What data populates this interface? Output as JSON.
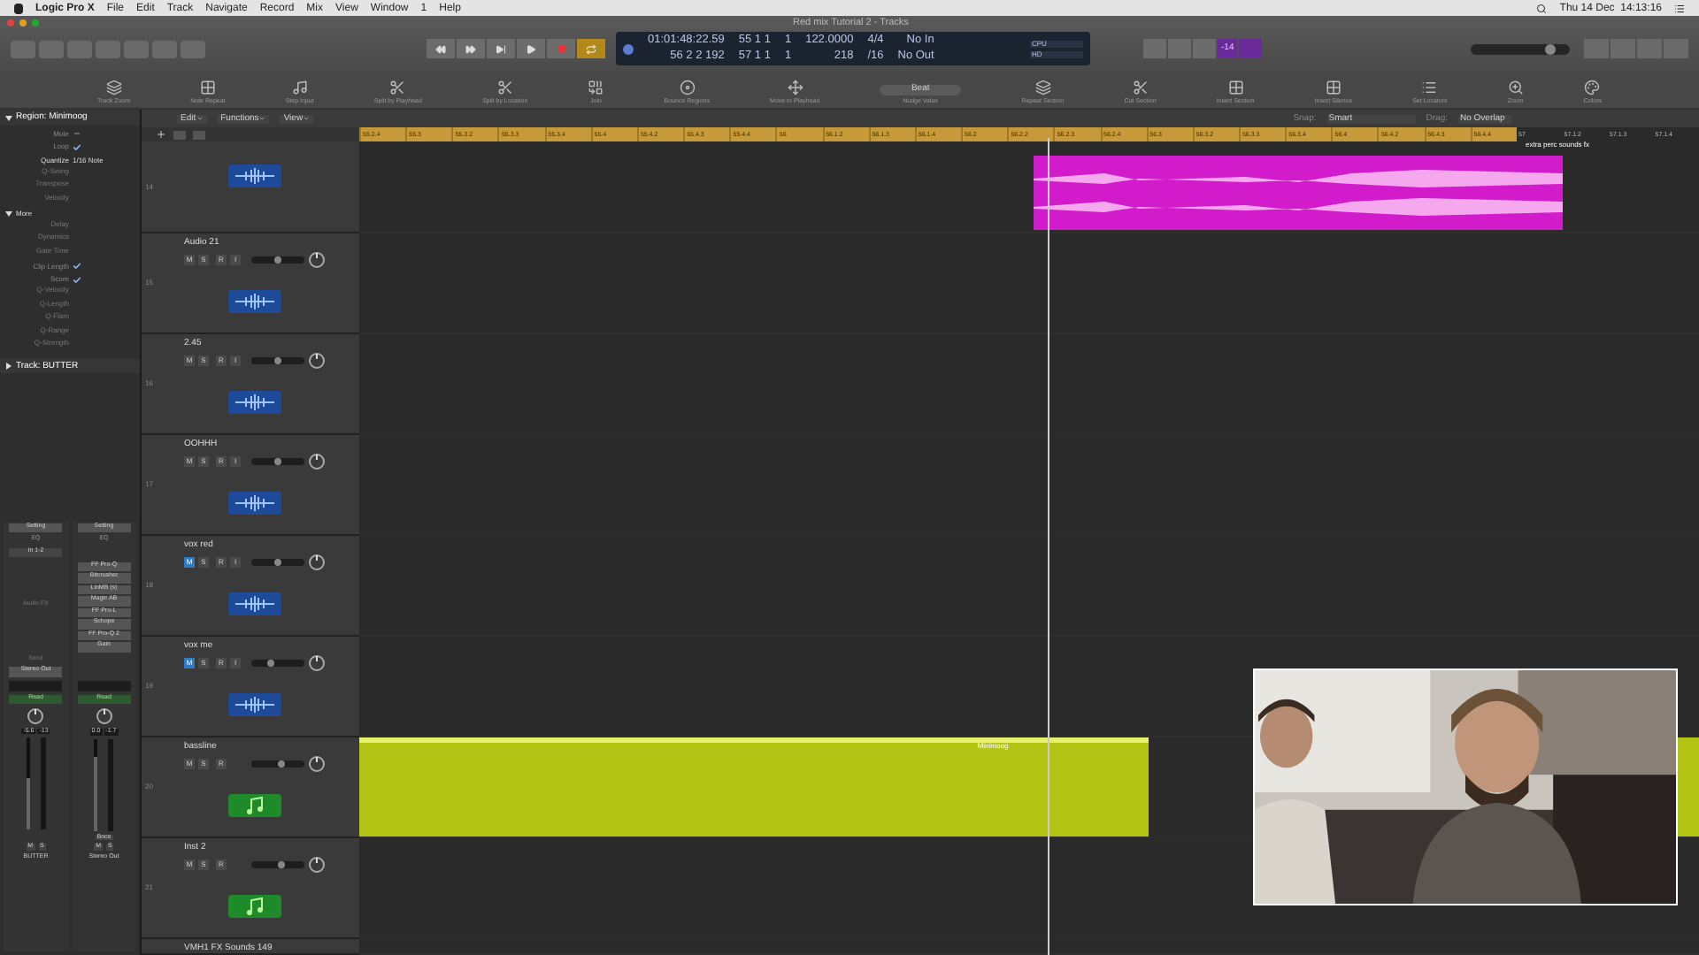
{
  "menu_bar": {
    "app": "Logic Pro X",
    "items": [
      "File",
      "Edit",
      "Track",
      "Navigate",
      "Record",
      "Mix",
      "View",
      "Window",
      "1",
      "Help"
    ],
    "clock": "Thu 14 Dec  14:13:16"
  },
  "window": {
    "title": "Red mix Tutorial 2 - Tracks"
  },
  "lcd": {
    "rows": [
      [
        "01:01:48:22.59",
        "55 1 1",
        "1",
        "122.0000",
        "4/4",
        "No In"
      ],
      [
        "56 2 2 192",
        "57 1 1",
        "1",
        "218",
        "/16",
        "No Out"
      ]
    ],
    "meters": [
      "CPU",
      "HD"
    ]
  },
  "purple_badge": "-14",
  "master_volume": {
    "level": 0.8
  },
  "toolbar": [
    {
      "label": "Track Zoom"
    },
    {
      "label": "Note Repeat"
    },
    {
      "label": "Step Input"
    },
    {
      "label": "Split by Playhead"
    },
    {
      "label": "Split by Location"
    },
    {
      "label": "Join"
    },
    {
      "label": "Bounce Regions"
    },
    {
      "label": "Move to Playhead"
    },
    {
      "label": "Nudge Value",
      "value": "Beat"
    },
    {
      "label": "Repeat Section"
    },
    {
      "label": "Cut Section"
    },
    {
      "label": "Insert Section"
    },
    {
      "label": "Insert Silence"
    },
    {
      "label": "Set Locators"
    },
    {
      "label": "Zoom"
    },
    {
      "label": "Colors"
    }
  ],
  "inspector": {
    "title": "Region: Minimoog",
    "rows": [
      {
        "label": "Mute",
        "kind": "check",
        "checked": false
      },
      {
        "label": "Loop",
        "kind": "check",
        "checked": true
      },
      {
        "label": "Quantize",
        "kind": "value",
        "value": "1/16 Note"
      },
      {
        "label": "Q-Swing",
        "kind": "plain"
      },
      {
        "label": "Transpose",
        "kind": "plain"
      },
      {
        "label": "Velocity",
        "kind": "plain"
      },
      {
        "label": "More",
        "kind": "section"
      },
      {
        "label": "Delay",
        "kind": "plain"
      },
      {
        "label": "Dynamics",
        "kind": "plain"
      },
      {
        "label": "Gate Time",
        "kind": "plain"
      },
      {
        "label": "Clip Length",
        "kind": "check",
        "checked": true
      },
      {
        "label": "Score",
        "kind": "check",
        "checked": true
      },
      {
        "label": "Q-Velocity",
        "kind": "plain"
      },
      {
        "label": "Q-Length",
        "kind": "plain"
      },
      {
        "label": "Q-Flam",
        "kind": "plain"
      },
      {
        "label": "Q-Range",
        "kind": "plain"
      },
      {
        "label": "Q-Strength",
        "kind": "plain"
      }
    ],
    "track_title": "Track: BUTTER"
  },
  "strips": [
    {
      "setting": "Setting",
      "eq": "EQ",
      "input": "In 1-2",
      "plugins": [
        "Audio FX"
      ],
      "send": "Send",
      "output": "Stereo Out",
      "automation": "Read",
      "readouts": [
        "-5.6",
        "-13"
      ],
      "level": 0.55,
      "buttons": [
        "M",
        "S"
      ],
      "name": "BUTTER"
    },
    {
      "setting": "Setting",
      "eq": "EQ",
      "plugins": [
        "FF Pro-Q",
        "Bitcrusher",
        "LinMB (s)",
        "Magic AB",
        "FF Pro-L",
        "Schope",
        "FF Pro-Q 2",
        "Gain"
      ],
      "automation": "Read",
      "readouts": [
        "0.0",
        "-1.7"
      ],
      "level": 0.8,
      "bounce": "Bnce",
      "buttons": [
        "M",
        "S"
      ],
      "name": "Stereo Out"
    }
  ],
  "edit_menus": [
    "Edit",
    "Functions",
    "View"
  ],
  "snap": {
    "label": "Snap:",
    "value": "Smart"
  },
  "drag": {
    "label": "Drag:",
    "value": "No Overlap"
  },
  "ruler": [
    "55.2.4",
    "55.3",
    "55.3.2",
    "55.3.3",
    "55.3.4",
    "55.4",
    "55.4.2",
    "55.4.3",
    "55.4.4",
    "56",
    "56.1.2",
    "56.1.3",
    "56.1.4",
    "56.2",
    "56.2.2",
    "56.2.3",
    "56.2.4",
    "56.3",
    "56.3.2",
    "56.3.3",
    "56.3.4",
    "56.4",
    "56.4.2",
    "56.4.3",
    "56.4.4",
    "57",
    "57.1.2",
    "57.1.3",
    "57.1.4"
  ],
  "tracks": [
    {
      "number": "14",
      "kind": "audio",
      "region": {
        "name": "extra perc sounds fx",
        "color": "#d21ccc"
      }
    },
    {
      "number": "15",
      "name": "Audio 21",
      "kind": "audio",
      "muted": false,
      "level": 0.5,
      "buttons": [
        "M",
        "S",
        "R",
        "I"
      ]
    },
    {
      "number": "16",
      "name": "2.45",
      "kind": "audio",
      "muted": false,
      "level": 0.5,
      "buttons": [
        "M",
        "S",
        "R",
        "I"
      ]
    },
    {
      "number": "17",
      "name": "OOHHH",
      "kind": "audio",
      "muted": false,
      "level": 0.5,
      "buttons": [
        "M",
        "S",
        "R",
        "I"
      ]
    },
    {
      "number": "18",
      "name": "vox red",
      "kind": "audio",
      "muted": true,
      "level": 0.5,
      "buttons": [
        "M",
        "S",
        "R",
        "I"
      ]
    },
    {
      "number": "19",
      "name": "vox me",
      "kind": "audio",
      "muted": true,
      "level": 0.35,
      "buttons": [
        "M",
        "S",
        "R",
        "I"
      ]
    },
    {
      "number": "20",
      "name": "bassline",
      "kind": "instrument",
      "muted": false,
      "level": 0.58,
      "buttons": [
        "M",
        "S",
        "R"
      ],
      "region": {
        "name": "Minimoog",
        "color": "#b3c414"
      }
    },
    {
      "number": "21",
      "name": "Inst 2",
      "kind": "instrument",
      "muted": false,
      "level": 0.58,
      "buttons": [
        "M",
        "S",
        "R"
      ]
    },
    {
      "name": "VMH1 FX Sounds 149",
      "kind": "partial"
    }
  ],
  "webcam": {
    "kind": "picture"
  }
}
